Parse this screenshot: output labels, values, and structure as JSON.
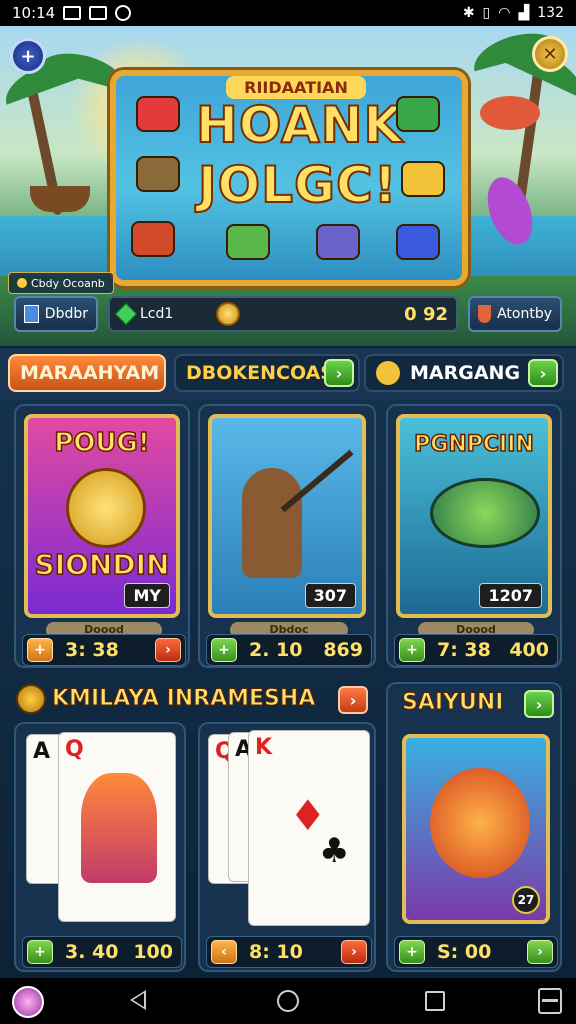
{
  "status_bar": {
    "time": "10:14",
    "battery": "132"
  },
  "banner": {
    "subtitle": "RIIDAATIAN",
    "title_line1": "HOANK",
    "title_line2": "JOLGC!",
    "info_label": "Cbdy Ocoanb"
  },
  "resources": {
    "left_label": "Dbdbr",
    "mid_label": "Lcd1",
    "mid_value": "0 92",
    "right_label": "Atontby"
  },
  "tabs": [
    {
      "label": "MARAAHYAM"
    },
    {
      "label": "DBOKENCOAS"
    },
    {
      "label": "MARGANG"
    }
  ],
  "cards_top": [
    {
      "title_top": "POUG!",
      "title_bottom": "SIONDIN",
      "tag": "MY",
      "plate": "Doood",
      "bar_left": "3: 38",
      "bar_right": ""
    },
    {
      "title_top": "",
      "title_bottom": "",
      "tag": "307",
      "plate": "Dbdoc",
      "bar_left": "2. 10",
      "bar_right": "869"
    },
    {
      "title_top": "PGNPCIIN",
      "title_bottom": "",
      "tag": "1207",
      "plate": "Doood",
      "bar_left": "7: 38",
      "bar_right": "400"
    }
  ],
  "cards_bottom": [
    {
      "title": "KMILAYA INRAMESHA",
      "bar_left": "3. 40",
      "bar_right": "100"
    },
    {
      "title": "",
      "bar_left": "8: 10",
      "bar_right": ""
    },
    {
      "title": "SAIYUNI",
      "bar_left": "S: 00",
      "bar_right": "",
      "badge": "27"
    }
  ],
  "playing_cards": {
    "left_a": "A",
    "left_b": "Q",
    "mid_a": "Q",
    "mid_b": "A",
    "mid_c": "K"
  },
  "colors": {
    "accent_gold": "#ffe066",
    "tab_active": "#ff8a3a",
    "card_border": "#e2bd53"
  }
}
